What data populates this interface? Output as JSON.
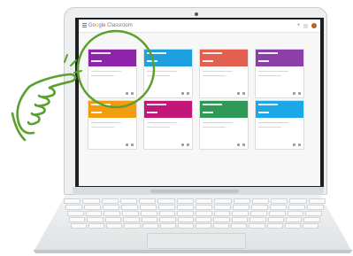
{
  "app": {
    "logo_google": "Google",
    "logo_product": "Classroom",
    "add_icon": "plus-icon",
    "apps_icon": "grid-icon",
    "account": "avatar"
  },
  "colors": {
    "purple": "#8e24aa",
    "blue": "#1e9fe0",
    "red": "#e35f4f",
    "violet": "#8b3fa8",
    "orange": "#f39c12",
    "magenta": "#c21779",
    "green": "#2e9a55",
    "sky": "#1ca7e6",
    "highlight": "#5aa02c"
  },
  "classes": [
    {
      "color": "#8e24aa"
    },
    {
      "color": "#1e9fe0"
    },
    {
      "color": "#e35f4f"
    },
    {
      "color": "#8b3fa8"
    },
    {
      "color": "#f39c12"
    },
    {
      "color": "#c21779"
    },
    {
      "color": "#2e9a55"
    },
    {
      "color": "#1ca7e6"
    }
  ],
  "overlay": {
    "hand_icon": "pointing-hand-icon",
    "circle_icon": "highlight-circle-icon"
  }
}
